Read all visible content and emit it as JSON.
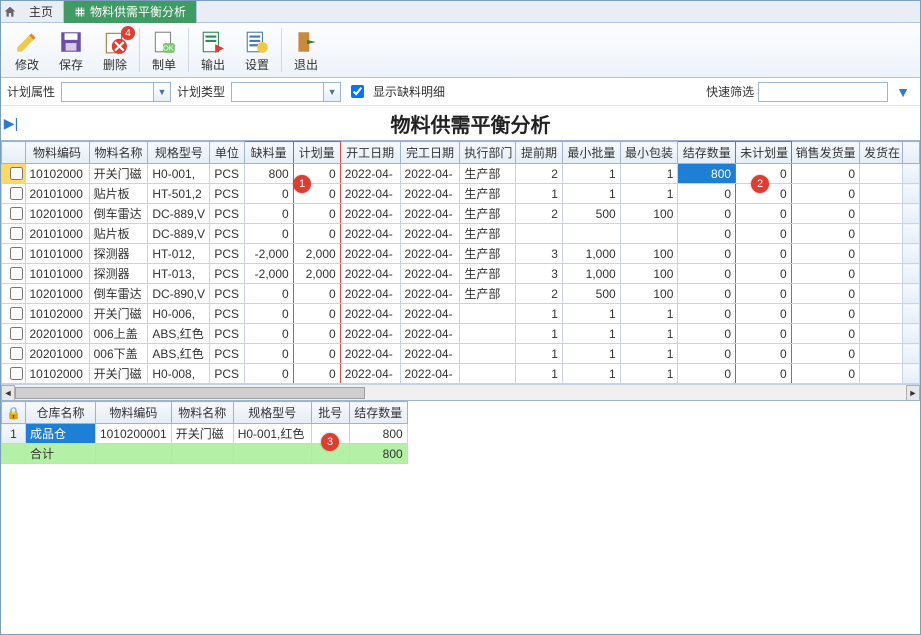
{
  "tabs": {
    "home": "主页",
    "active": "物料供需平衡分析"
  },
  "toolbar": {
    "modify": "修改",
    "save": "保存",
    "delete": "删除",
    "make": "制单",
    "output": "输出",
    "settings": "设置",
    "exit": "退出",
    "delete_badge": "4"
  },
  "filters": {
    "plan_attr_label": "计划属性",
    "plan_type_label": "计划类型",
    "show_short_label": "显示缺料明细",
    "quick_label": "快速筛选"
  },
  "title": "物料供需平衡分析",
  "callouts": {
    "c1": "1",
    "c2": "2",
    "c3": "3"
  },
  "columns": [
    "物料编码",
    "物料名称",
    "规格型号",
    "单位",
    "缺料量",
    "计划量",
    "开工日期",
    "完工日期",
    "执行部门",
    "提前期",
    "最小批量",
    "最小包装",
    "结存数量",
    "未计划量",
    "销售发货量",
    "发货在"
  ],
  "rows": [
    {
      "code": "10102000",
      "name": "开关门磁",
      "spec": "H0-001,",
      "unit": "PCS",
      "short": "800",
      "plan": "0",
      "start": "2022-04-",
      "end": "2022-04-",
      "dept": "生产部",
      "lead": "2",
      "minlot": "1",
      "minpack": "1",
      "stock": "800",
      "unplan": "0",
      "ship": "0"
    },
    {
      "code": "20101000",
      "name": "贴片板",
      "spec": "HT-501,2",
      "unit": "PCS",
      "short": "0",
      "plan": "0",
      "start": "2022-04-",
      "end": "2022-04-",
      "dept": "生产部",
      "lead": "1",
      "minlot": "1",
      "minpack": "1",
      "stock": "0",
      "unplan": "0",
      "ship": "0"
    },
    {
      "code": "10201000",
      "name": "倒车雷达",
      "spec": "DC-889,V",
      "unit": "PCS",
      "short": "0",
      "plan": "0",
      "start": "2022-04-",
      "end": "2022-04-",
      "dept": "生产部",
      "lead": "2",
      "minlot": "500",
      "minpack": "100",
      "stock": "0",
      "unplan": "0",
      "ship": "0"
    },
    {
      "code": "20101000",
      "name": "贴片板",
      "spec": "DC-889,V",
      "unit": "PCS",
      "short": "0",
      "plan": "0",
      "start": "2022-04-",
      "end": "2022-04-",
      "dept": "生产部",
      "lead": "",
      "minlot": "",
      "minpack": "",
      "stock": "0",
      "unplan": "0",
      "ship": "0"
    },
    {
      "code": "10101000",
      "name": "探测器",
      "spec": "HT-012,",
      "unit": "PCS",
      "short": "-2,000",
      "plan": "2,000",
      "start": "2022-04-",
      "end": "2022-04-",
      "dept": "生产部",
      "lead": "3",
      "minlot": "1,000",
      "minpack": "100",
      "stock": "0",
      "unplan": "0",
      "ship": "0"
    },
    {
      "code": "10101000",
      "name": "探测器",
      "spec": "HT-013,",
      "unit": "PCS",
      "short": "-2,000",
      "plan": "2,000",
      "start": "2022-04-",
      "end": "2022-04-",
      "dept": "生产部",
      "lead": "3",
      "minlot": "1,000",
      "minpack": "100",
      "stock": "0",
      "unplan": "0",
      "ship": "0"
    },
    {
      "code": "10201000",
      "name": "倒车雷达",
      "spec": "DC-890,V",
      "unit": "PCS",
      "short": "0",
      "plan": "0",
      "start": "2022-04-",
      "end": "2022-04-",
      "dept": "生产部",
      "lead": "2",
      "minlot": "500",
      "minpack": "100",
      "stock": "0",
      "unplan": "0",
      "ship": "0"
    },
    {
      "code": "10102000",
      "name": "开关门磁",
      "spec": "H0-006,",
      "unit": "PCS",
      "short": "0",
      "plan": "0",
      "start": "2022-04-",
      "end": "2022-04-",
      "dept": "",
      "lead": "1",
      "minlot": "1",
      "minpack": "1",
      "stock": "0",
      "unplan": "0",
      "ship": "0"
    },
    {
      "code": "20201000",
      "name": "006上盖",
      "spec": "ABS,红色",
      "unit": "PCS",
      "short": "0",
      "plan": "0",
      "start": "2022-04-",
      "end": "2022-04-",
      "dept": "",
      "lead": "1",
      "minlot": "1",
      "minpack": "1",
      "stock": "0",
      "unplan": "0",
      "ship": "0"
    },
    {
      "code": "20201000",
      "name": "006下盖",
      "spec": "ABS,红色",
      "unit": "PCS",
      "short": "0",
      "plan": "0",
      "start": "2022-04-",
      "end": "2022-04-",
      "dept": "",
      "lead": "1",
      "minlot": "1",
      "minpack": "1",
      "stock": "0",
      "unplan": "0",
      "ship": "0"
    },
    {
      "code": "10102000",
      "name": "开关门磁",
      "spec": "H0-008,",
      "unit": "PCS",
      "short": "0",
      "plan": "0",
      "start": "2022-04-",
      "end": "2022-04-",
      "dept": "",
      "lead": "1",
      "minlot": "1",
      "minpack": "1",
      "stock": "0",
      "unplan": "0",
      "ship": "0"
    }
  ],
  "sub_columns": [
    "仓库名称",
    "物料编码",
    "物料名称",
    "规格型号",
    "批号",
    "结存数量"
  ],
  "sub_rows": [
    {
      "idx": "1",
      "wh": "成品仓",
      "code": "1010200001",
      "name": "开关门磁",
      "spec": "H0-001,红色",
      "lot": "",
      "stock": "800"
    }
  ],
  "sub_total_label": "合计",
  "sub_total_stock": "800"
}
